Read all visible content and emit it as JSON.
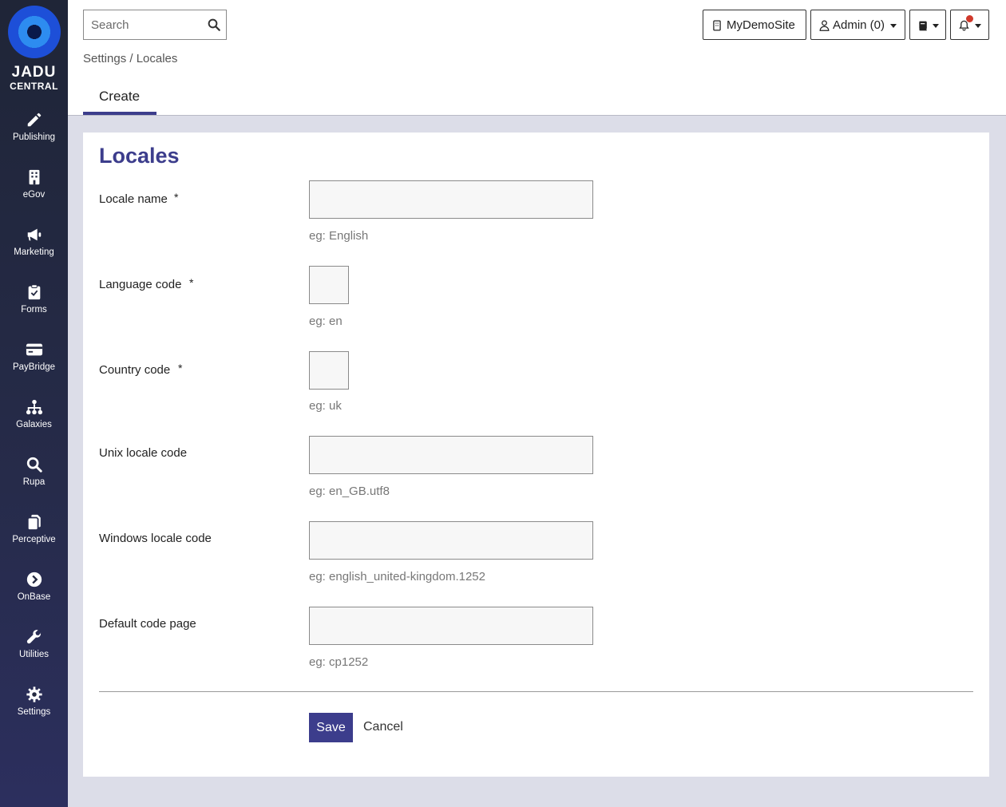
{
  "brand": {
    "line1": "JADU",
    "line2": "CENTRAL"
  },
  "nav": [
    {
      "label": "Publishing",
      "icon": "pencil-icon"
    },
    {
      "label": "eGov",
      "icon": "building-icon"
    },
    {
      "label": "Marketing",
      "icon": "megaphone-icon"
    },
    {
      "label": "Forms",
      "icon": "clipboard-icon"
    },
    {
      "label": "PayBridge",
      "icon": "credit-card-icon"
    },
    {
      "label": "Galaxies",
      "icon": "sitemap-icon"
    },
    {
      "label": "Rupa",
      "icon": "search-icon"
    },
    {
      "label": "Perceptive",
      "icon": "copy-icon"
    },
    {
      "label": "OnBase",
      "icon": "chevron-circle-icon"
    },
    {
      "label": "Utilities",
      "icon": "wrench-icon"
    },
    {
      "label": "Settings",
      "icon": "gear-icon"
    }
  ],
  "search": {
    "placeholder": "Search"
  },
  "topbar": {
    "site": "MyDemoSite",
    "user": "Admin (0)"
  },
  "breadcrumb": {
    "path": "Settings / Locales"
  },
  "tabs": [
    {
      "label": "Create"
    }
  ],
  "form": {
    "title": "Locales",
    "required_mark": "*",
    "fields": [
      {
        "label": "Locale name",
        "hint": "eg: English",
        "value": ""
      },
      {
        "label": "Language code",
        "hint": "eg: en",
        "value": ""
      },
      {
        "label": "Country code",
        "hint": "eg: uk",
        "value": ""
      },
      {
        "label": "Unix locale code",
        "hint": "eg: en_GB.utf8",
        "value": ""
      },
      {
        "label": "Windows locale code",
        "hint": "eg: english_united-kingdom.1252",
        "value": ""
      },
      {
        "label": "Default code page",
        "hint": "eg: cp1252",
        "value": ""
      }
    ],
    "save": "Save",
    "cancel": "Cancel"
  },
  "colors": {
    "accent": "#3c3d8c",
    "sidebar": "#242940",
    "notification": "#d0392b"
  }
}
